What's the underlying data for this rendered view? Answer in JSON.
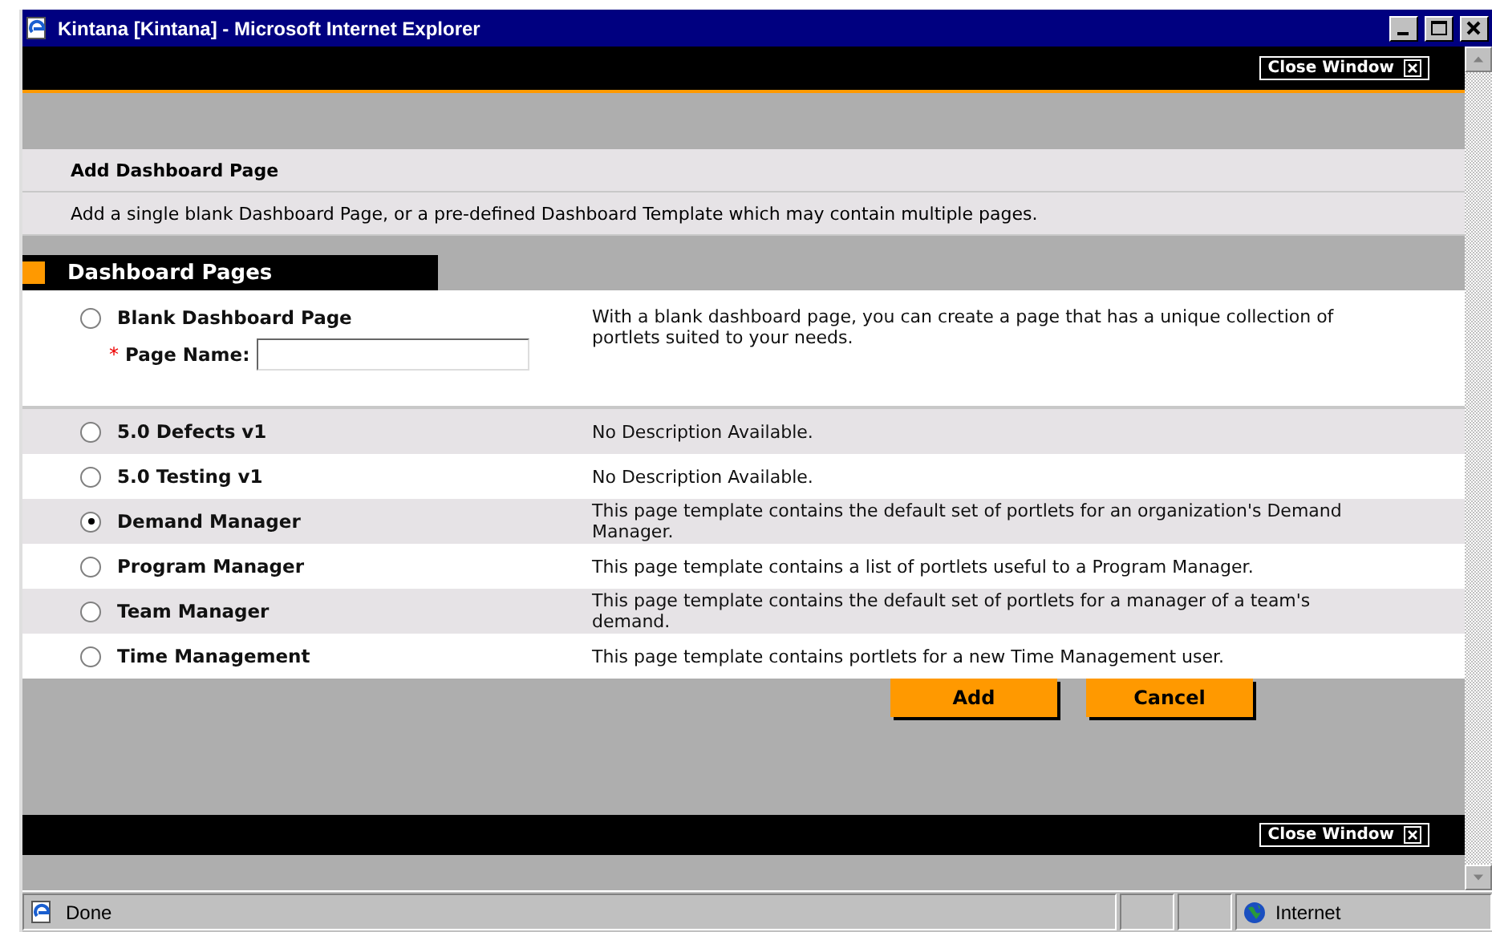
{
  "window": {
    "title": "Kintana [Kintana] - Microsoft Internet Explorer"
  },
  "top_bar": {
    "close_label": "Close Window"
  },
  "page_header": {
    "title": "Add Dashboard Page",
    "description": "Add a single blank Dashboard Page, or a pre-defined Dashboard Template which may contain multiple pages."
  },
  "section": {
    "title": "Dashboard Pages"
  },
  "options": [
    {
      "kind": "blank",
      "label": "Blank Dashboard Page",
      "selected": false,
      "description": "With a blank dashboard page, you can create a page that has a unique collection of portlets suited to your needs.",
      "field": {
        "required_mark": "*",
        "label": "Page Name:"
      }
    },
    {
      "kind": "template",
      "label": "5.0 Defects v1",
      "selected": false,
      "description": "No Description Available."
    },
    {
      "kind": "template",
      "label": "5.0 Testing v1",
      "selected": false,
      "description": "No Description Available."
    },
    {
      "kind": "template",
      "label": "Demand Manager",
      "selected": true,
      "description": "This page template contains the default set of portlets for an organization's Demand Manager."
    },
    {
      "kind": "template",
      "label": "Program Manager",
      "selected": false,
      "description": "This page template contains a list of portlets useful to a Program Manager."
    },
    {
      "kind": "template",
      "label": "Team Manager",
      "selected": false,
      "description": "This page template contains the default set of portlets for a manager of a team's demand."
    },
    {
      "kind": "template",
      "label": "Time Management",
      "selected": false,
      "description": "This page template contains portlets for a new Time Management user."
    }
  ],
  "buttons": [
    "Add",
    "Cancel"
  ],
  "bottom_bar": {
    "close_label": "Close Window"
  },
  "status_bar": {
    "status": "Done",
    "zone": "Internet"
  }
}
